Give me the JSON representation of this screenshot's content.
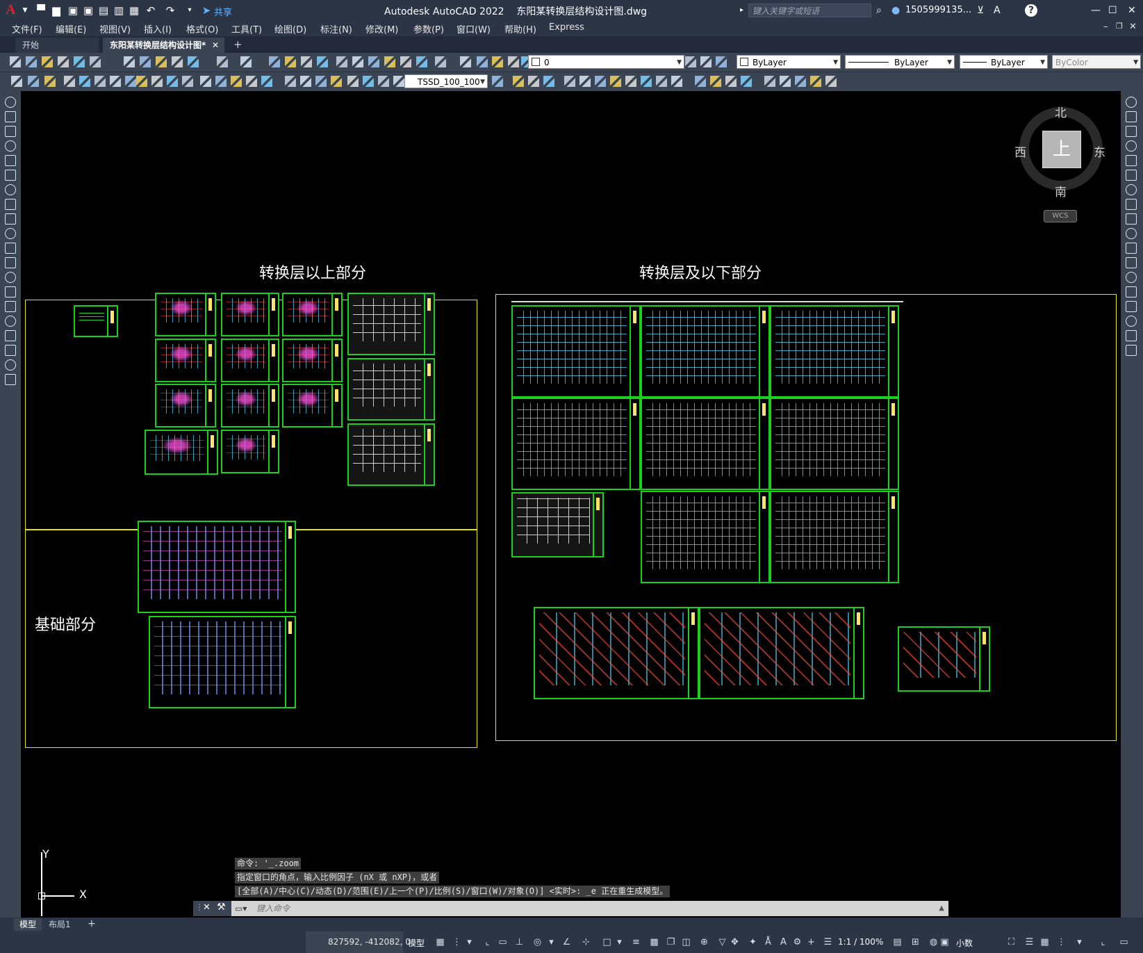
{
  "window": {
    "app_letter": "A",
    "title": "Autodesk AutoCAD 2022    东阳某转换层结构设计图.dwg",
    "share_label": "共享",
    "search_placeholder": "键入关键字或短语",
    "user_name": "1505999135...",
    "controls": {
      "minimize": "—",
      "restore": "☐",
      "close": "✕",
      "help": "?"
    }
  },
  "menu": [
    "文件(F)",
    "编辑(E)",
    "视图(V)",
    "插入(I)",
    "格式(O)",
    "工具(T)",
    "绘图(D)",
    "标注(N)",
    "修改(M)",
    "参数(P)",
    "窗口(W)",
    "帮助(H)",
    "Express"
  ],
  "tabs": {
    "start": "开始",
    "document": "东阳某转换层结构设计图*",
    "close_glyph": "✕",
    "add_glyph": "+"
  },
  "toolbar": {
    "layer_value": "0",
    "color_value": "ByLayer",
    "linetype_value": "ByLayer",
    "lineweight_value": "ByLayer",
    "plotstyle_value": "ByColor",
    "dimstyle_value": "TSSD_100_100"
  },
  "drawing": {
    "labels": {
      "above": "转换层以上部分",
      "below": "转换层及以下部分",
      "foundation": "基础部分"
    }
  },
  "viewcube": {
    "north": "北",
    "south": "南",
    "east": "东",
    "west": "西",
    "top_face": "上",
    "wcs": "WCS"
  },
  "ucs": {
    "x": "X",
    "y": "Y"
  },
  "command": {
    "history": [
      "命令: '_.zoom",
      "指定窗口的角点，输入比例因子 (nX 或 nXP)，或者",
      "[全部(A)/中心(C)/动态(D)/范围(E)/上一个(P)/比例(S)/窗口(W)/对象(O)] <实时>: _e 正在重生成模型。"
    ],
    "placeholder": "键入命令"
  },
  "layout_tabs": {
    "model": "模型",
    "layout1": "布局1",
    "add": "+"
  },
  "status": {
    "coords": "827592, -412082, 0",
    "space": "模型",
    "scale": "1:1 / 100%",
    "units": "小数"
  },
  "colors": {
    "frame_yellow": "#e6e600",
    "sheet_green": "#19d119",
    "ui_dark": "#2b3546",
    "toolbar": "#3b4453"
  }
}
